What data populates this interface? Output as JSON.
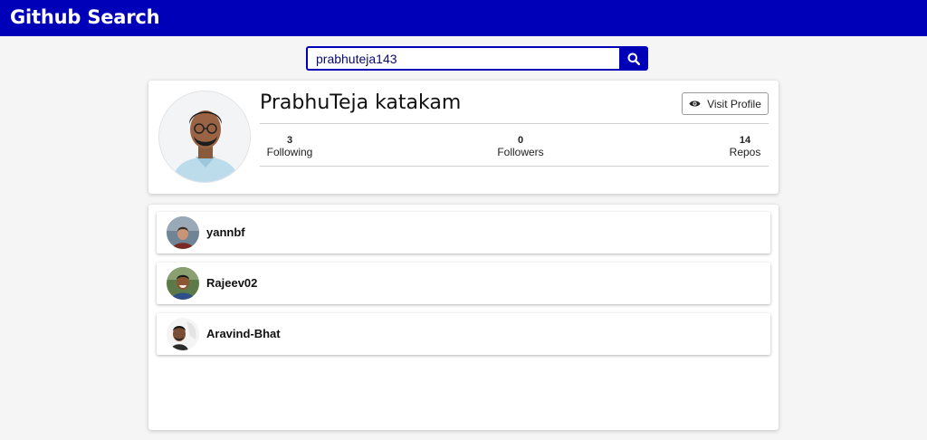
{
  "header": {
    "title": "Github Search",
    "bg_color": "#0000b8"
  },
  "search": {
    "value": "prabhuteja143",
    "icon": "search-icon"
  },
  "profile": {
    "name": "PrabhuTeja katakam",
    "visit_label": "Visit Profile",
    "visit_icon": "eye-icon",
    "stats": [
      {
        "value": "3",
        "label": "Following"
      },
      {
        "value": "0",
        "label": "Followers"
      },
      {
        "value": "14",
        "label": "Repos"
      }
    ]
  },
  "users": [
    {
      "name": "yannbf"
    },
    {
      "name": "Rajeev02"
    },
    {
      "name": "Aravind-Bhat"
    }
  ]
}
